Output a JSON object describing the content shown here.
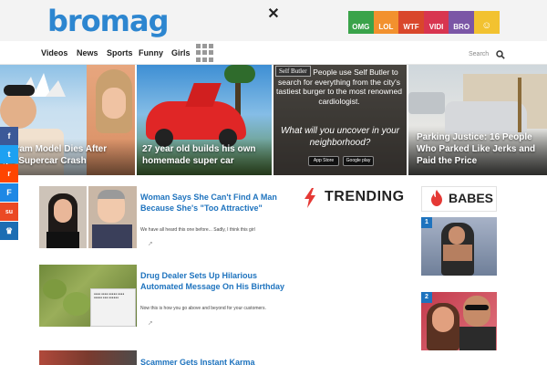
{
  "header": {
    "logo": "bromag",
    "close_symbol": "✕",
    "reactions": [
      {
        "label": "OMG",
        "color": "#3aa34a"
      },
      {
        "label": "LOL",
        "color": "#f2912e"
      },
      {
        "label": "WTF",
        "color": "#d9472b"
      },
      {
        "label": "VIDI",
        "color": "#d83550"
      },
      {
        "label": "BRO",
        "color": "#7b56a6"
      },
      {
        "label": "☺",
        "color": "#f2c230"
      }
    ]
  },
  "nav": {
    "items": [
      "Videos",
      "News",
      "Sports",
      "Funny",
      "Girls"
    ],
    "search_label": "Search"
  },
  "hero": [
    {
      "caption": "Instagram Model Dies After\nTragic Supercar Crash"
    },
    {
      "caption": "27 year old builds his own\nhomemade super car"
    },
    {
      "badge": "Self Butler",
      "ad_text": "People use Self Butler to search for everything from the city's tastiest burger to the most renowned cardiologist.",
      "ad_question": "What will you uncover in your neighborhood?",
      "app_store": "App Store",
      "google_play": "Google play"
    },
    {
      "caption": "Parking Justice: 16 People\nWho Parked Like Jerks and\nPaid the Price"
    }
  ],
  "social": [
    {
      "icon": "f",
      "color": "#3b5998"
    },
    {
      "icon": "t",
      "color": "#1da1f2"
    },
    {
      "icon": "r",
      "color": "#ff4500"
    },
    {
      "icon": "F",
      "color": "#1e88e5"
    },
    {
      "icon": "su",
      "color": "#eb4924"
    },
    {
      "icon": "♛",
      "color": "#1c6db3"
    }
  ],
  "articles": [
    {
      "title": "Woman Says She Can't Find A Man Because She's \"Too Attractive\"",
      "desc": "We have all heard this one before... Sadly, I think this girl"
    },
    {
      "title": "Drug Dealer Sets Up Hilarious Automated Message On His Birthday",
      "desc": "Now this is how you go above and beyond for your customers."
    },
    {
      "title": "Scammer Gets Instant Karma",
      "desc": ""
    }
  ],
  "trending": {
    "title": "TRENDING"
  },
  "babes": {
    "title": "BABES",
    "ranks": [
      "1",
      "2"
    ]
  },
  "colors": {
    "accent": "#1e73be",
    "logo": "#2d86d0",
    "trend_red": "#e53935"
  }
}
